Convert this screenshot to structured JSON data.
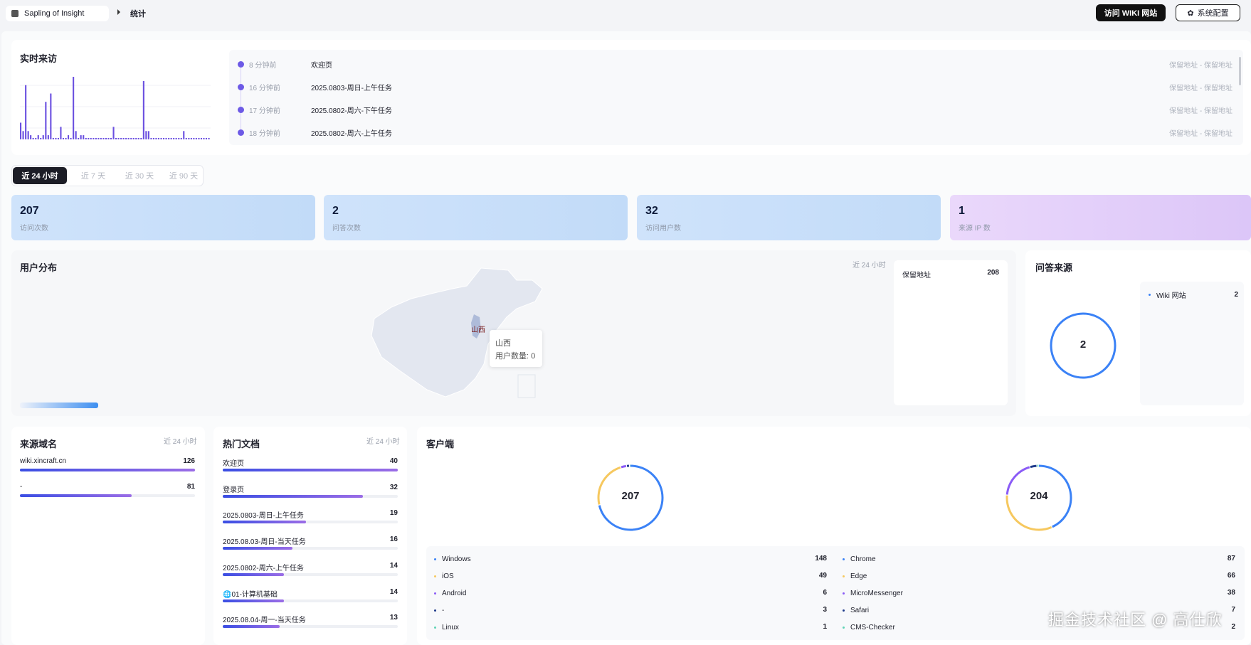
{
  "topbar": {
    "brand": "Sapling of Insight",
    "breadcrumb": "统计",
    "visit_wiki": "访问 WIKI 网站",
    "settings": "系统配置"
  },
  "realtime": {
    "title": "实时来访",
    "bars": [
      4,
      2,
      13,
      2,
      1,
      0,
      0,
      1,
      0,
      1,
      9,
      1,
      11,
      0,
      0,
      0,
      3,
      0,
      0,
      1,
      0,
      15,
      2,
      0,
      1,
      1,
      0,
      0,
      0,
      0,
      0,
      0,
      0,
      0,
      0,
      0,
      0,
      3,
      0,
      0,
      0,
      0,
      0,
      0,
      0,
      0,
      0,
      0,
      0,
      14,
      2,
      2,
      0,
      0,
      0,
      0,
      0,
      0,
      0,
      0,
      0,
      0,
      0,
      0,
      0,
      2,
      0,
      0,
      0,
      0,
      0,
      0,
      0,
      0,
      0,
      0
    ],
    "visits": [
      {
        "time": "8 分钟前",
        "page": "欢迎页",
        "addr": "保留地址 - 保留地址"
      },
      {
        "time": "16 分钟前",
        "page": "2025.0803-周日-上午任务",
        "addr": "保留地址 - 保留地址"
      },
      {
        "time": "17 分钟前",
        "page": "2025.0802-周六-下午任务",
        "addr": "保留地址 - 保留地址"
      },
      {
        "time": "18 分钟前",
        "page": "2025.0802-周六-上午任务",
        "addr": "保留地址 - 保留地址"
      }
    ]
  },
  "tabs": [
    "近 24 小时",
    "近 7 天",
    "近 30 天",
    "近 90 天"
  ],
  "stats": [
    {
      "value": "207",
      "label": "访问次数"
    },
    {
      "value": "2",
      "label": "问答次数"
    },
    {
      "value": "32",
      "label": "访问用户数"
    },
    {
      "value": "1",
      "label": "来源 IP 数"
    }
  ],
  "distribution": {
    "title": "用户分布",
    "range": "近 24 小时",
    "map_label": "山西",
    "tooltip_title": "山西",
    "tooltip_text": "用户数量: 0",
    "region_list": [
      {
        "name": "保留地址",
        "value": "208"
      }
    ]
  },
  "qa_source": {
    "title": "问答来源",
    "center": "2",
    "items": [
      {
        "name": "Wiki 网站",
        "value": "2"
      }
    ]
  },
  "domains": {
    "title": "来源域名",
    "range": "近 24 小时",
    "items": [
      {
        "name": "wiki.xincraft.cn",
        "value": "126",
        "pct": 1.0
      },
      {
        "name": "-",
        "value": "81",
        "pct": 0.64
      }
    ]
  },
  "hot_docs": {
    "title": "热门文档",
    "range": "近 24 小时",
    "items": [
      {
        "name": "欢迎页",
        "value": "40",
        "pct": 1.0
      },
      {
        "name": "登录页",
        "value": "32",
        "pct": 0.8
      },
      {
        "name": "2025.0803-周日-上午任务",
        "value": "19",
        "pct": 0.475
      },
      {
        "name": "2025.08.03-周日-当天任务",
        "value": "16",
        "pct": 0.4
      },
      {
        "name": "2025.0802-周六-上午任务",
        "value": "14",
        "pct": 0.35
      },
      {
        "name": "🌐01-计算机基础",
        "value": "14",
        "pct": 0.35
      },
      {
        "name": "2025.08.04-周一-当天任务",
        "value": "13",
        "pct": 0.325
      }
    ]
  },
  "clients": {
    "title": "客户端",
    "os_total": "207",
    "browser_total": "204",
    "os": [
      {
        "name": "Windows",
        "value": "148",
        "color": "#3b82f6"
      },
      {
        "name": "iOS",
        "value": "49",
        "color": "#f6c85f"
      },
      {
        "name": "Android",
        "value": "6",
        "color": "#8b5cf6"
      },
      {
        "name": "-",
        "value": "3",
        "color": "#1e3a8a"
      },
      {
        "name": "Linux",
        "value": "1",
        "color": "#5fd3b5"
      }
    ],
    "browsers": [
      {
        "name": "Chrome",
        "value": "87",
        "color": "#3b82f6"
      },
      {
        "name": "Edge",
        "value": "66",
        "color": "#f6c85f"
      },
      {
        "name": "MicroMessenger",
        "value": "38",
        "color": "#8b5cf6"
      },
      {
        "name": "Safari",
        "value": "7",
        "color": "#1e3a8a"
      },
      {
        "name": "CMS-Checker",
        "value": "2",
        "color": "#5fd3b5"
      }
    ]
  },
  "watermark": "掘金技术社区 @ 高仕欣"
}
